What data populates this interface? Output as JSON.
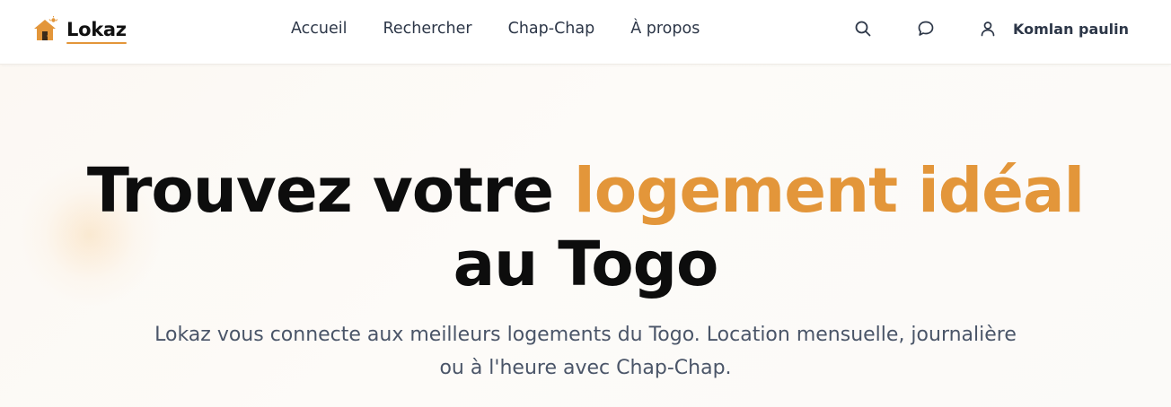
{
  "brand": {
    "name": "Lokaz",
    "accent_color": "#e3963a"
  },
  "nav": {
    "items": [
      {
        "label": "Accueil"
      },
      {
        "label": "Rechercher"
      },
      {
        "label": "Chap-Chap"
      },
      {
        "label": "À propos"
      }
    ]
  },
  "header_actions": {
    "search_icon": "search-icon",
    "messages_icon": "chat-bubble-icon",
    "user_icon": "user-icon",
    "user_name": "Komlan paulin"
  },
  "hero": {
    "title_part1": "Trouvez votre ",
    "title_accent": "logement idéal",
    "title_part2": "au Togo",
    "subtitle_line1": "Lokaz vous connecte aux meilleurs logements du Togo. Location mensuelle, journalière",
    "subtitle_line2": "ou à l'heure avec Chap-Chap."
  }
}
